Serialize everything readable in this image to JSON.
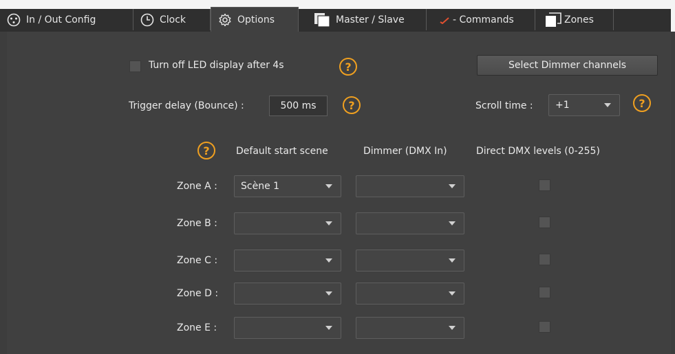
{
  "tabs": [
    {
      "label": "In / Out Config",
      "icon": "xlr-connector-icon"
    },
    {
      "label": "Clock",
      "icon": "clock-icon"
    },
    {
      "label": "Options",
      "icon": "gear-icon",
      "active": true
    },
    {
      "label": "Master / Slave",
      "icon": "master-slave-icon"
    },
    {
      "label": "- Commands",
      "icon": "checkmark-icon"
    },
    {
      "label": "Zones",
      "icon": "zones-icon"
    }
  ],
  "options": {
    "led_off_label": "Turn off LED display after 4s",
    "led_off_checked": false,
    "select_dimmer_button": "Select Dimmer channels",
    "trigger_delay_label": "Trigger delay (Bounce) :",
    "trigger_delay_value": "500 ms",
    "scroll_time_label": "Scroll time :",
    "scroll_time_value": "+1",
    "help_glyph": "?"
  },
  "zones_table": {
    "columns": [
      "Default start scene",
      "Dimmer (DMX In)",
      "Direct DMX levels (0-255)"
    ],
    "rows": [
      {
        "label": "Zone A :",
        "start_scene": "Scène 1",
        "dimmer": "",
        "direct_dmx": false
      },
      {
        "label": "Zone B :",
        "start_scene": "",
        "dimmer": "",
        "direct_dmx": false
      },
      {
        "label": "Zone C :",
        "start_scene": "",
        "dimmer": "",
        "direct_dmx": false
      },
      {
        "label": "Zone D :",
        "start_scene": "",
        "dimmer": "",
        "direct_dmx": false
      },
      {
        "label": "Zone E :",
        "start_scene": "",
        "dimmer": "",
        "direct_dmx": false
      }
    ]
  },
  "colors": {
    "help_accent": "#f0a020",
    "background": "#404040",
    "tab_bar": "#2f2f2f"
  }
}
